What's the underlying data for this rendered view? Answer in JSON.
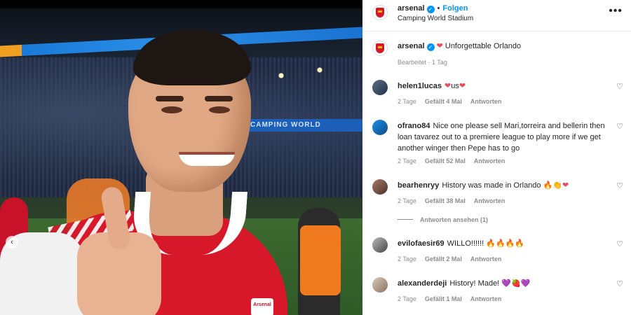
{
  "post": {
    "username": "arsenal",
    "verified_mark": "✓",
    "separator": "•",
    "follow_label": "Folgen",
    "location": "Camping World Stadium",
    "more_label": "•••",
    "photo_banner": "CAMPING WORLD",
    "crest_text": "Arsenal",
    "carousel_prev": "‹"
  },
  "caption": {
    "username": "arsenal",
    "emoji": "❤",
    "text": "Unforgettable Orlando",
    "meta": "Bearbeitet · 1 Tag"
  },
  "comments": [
    {
      "username": "helen1lucas",
      "text": "",
      "emojis": [
        "❤",
        "us",
        "❤"
      ],
      "time": "2 Tage",
      "likes": "Gefällt 4 Mal",
      "reply": "Antworten"
    },
    {
      "username": "ofrano84",
      "text": "Nice one please sell Mari,torreira and bellerin then loan tavarez out to a premiere league to play more if we get another winger then Pepe has to go",
      "time": "2 Tage",
      "likes": "Gefällt 52 Mal",
      "reply": "Antworten"
    },
    {
      "username": "bearhenryy",
      "text": "History was made in Orlando",
      "emojis": [
        "🔥",
        "👏",
        "❤"
      ],
      "time": "2 Tage",
      "likes": "Gefällt 38 Mal",
      "reply": "Antworten",
      "view_replies": "Antworten ansehen (1)"
    },
    {
      "username": "evilofaesir69",
      "text": "WILLO!!!!!!",
      "emojis": [
        "🔥",
        "🔥",
        "🔥",
        "🔥"
      ],
      "time": "2 Tage",
      "likes": "Gefällt 2 Mal",
      "reply": "Antworten"
    },
    {
      "username": "alexanderdeji",
      "text": "History! Made!",
      "emojis": [
        "💜",
        "🍓",
        "💜"
      ],
      "time": "2 Tage",
      "likes": "Gefällt 1 Mal",
      "reply": "Antworten"
    }
  ],
  "colors": {
    "link": "#0095f6",
    "heart": "#ed4956",
    "muted": "#8e8e8e",
    "text": "#262626",
    "arsenal_red": "#d6182a"
  },
  "icons": {
    "like": "heart-outline-icon",
    "more": "more-options-icon",
    "verified": "verified-badge-icon"
  }
}
